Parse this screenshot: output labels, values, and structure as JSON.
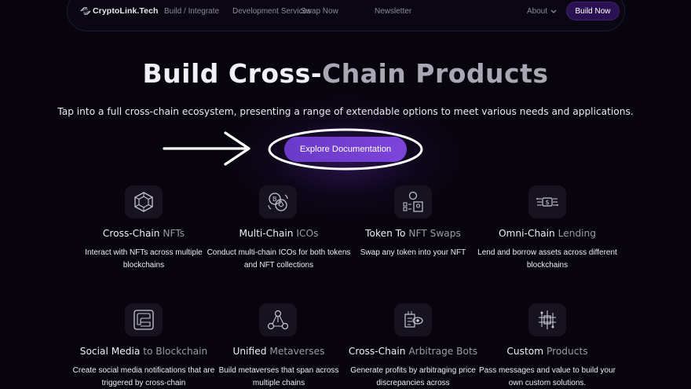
{
  "nav": {
    "brand": "CryptoLink.Tech",
    "links": [
      "Build / Integrate",
      "Development Services",
      "Swap Now",
      "Newsletter"
    ],
    "about": "About",
    "cta": "Build Now"
  },
  "hero": {
    "title_main": "Build Cross-",
    "title_accent": "Chain Products",
    "subtitle": "Tap into a full cross-chain ecosystem, presenting a range of extendable options to meet various needs and applications.",
    "cta": "Explore Documentation"
  },
  "cards": [
    {
      "title_a": "Cross-Chain ",
      "title_b": "NFTs",
      "desc": "Interact with NFTs across multiple blockchains",
      "icon": "cube-icon"
    },
    {
      "title_a": "Multi-Chain ",
      "title_b": "ICOs",
      "desc": "Conduct multi-chain ICOs for both tokens and NFT collections",
      "icon": "coins-exchange-icon"
    },
    {
      "title_a": "Token To ",
      "title_b": "NFT Swaps",
      "desc": "Swap any token into your NFT",
      "icon": "token-swap-icon"
    },
    {
      "title_a": "Omni-Chain ",
      "title_b": "Lending",
      "desc": "Lend and borrow assets across different blockchains",
      "icon": "lending-icon"
    },
    {
      "title_a": "Social Media ",
      "title_b": "to Blockchain",
      "desc": "Create social media notifications that are triggered by cross-chain",
      "icon": "social-icon"
    },
    {
      "title_a": "Unified ",
      "title_b": "Metaverses",
      "desc": "Build metaverses that span across multiple chains",
      "icon": "metaverse-icon"
    },
    {
      "title_a": "Cross-Chain ",
      "title_b": "Arbitrage Bots",
      "desc": "Generate profits by arbitraging price discrepancies across",
      "icon": "arbitrage-bot-icon"
    },
    {
      "title_a": "Custom ",
      "title_b": "Products",
      "desc": "Pass messages and value to build your own custom solutions.",
      "icon": "custom-products-icon"
    }
  ],
  "colors": {
    "background": "#07040d",
    "accent": "#7d44db",
    "muted_text": "#9d9aa8"
  }
}
